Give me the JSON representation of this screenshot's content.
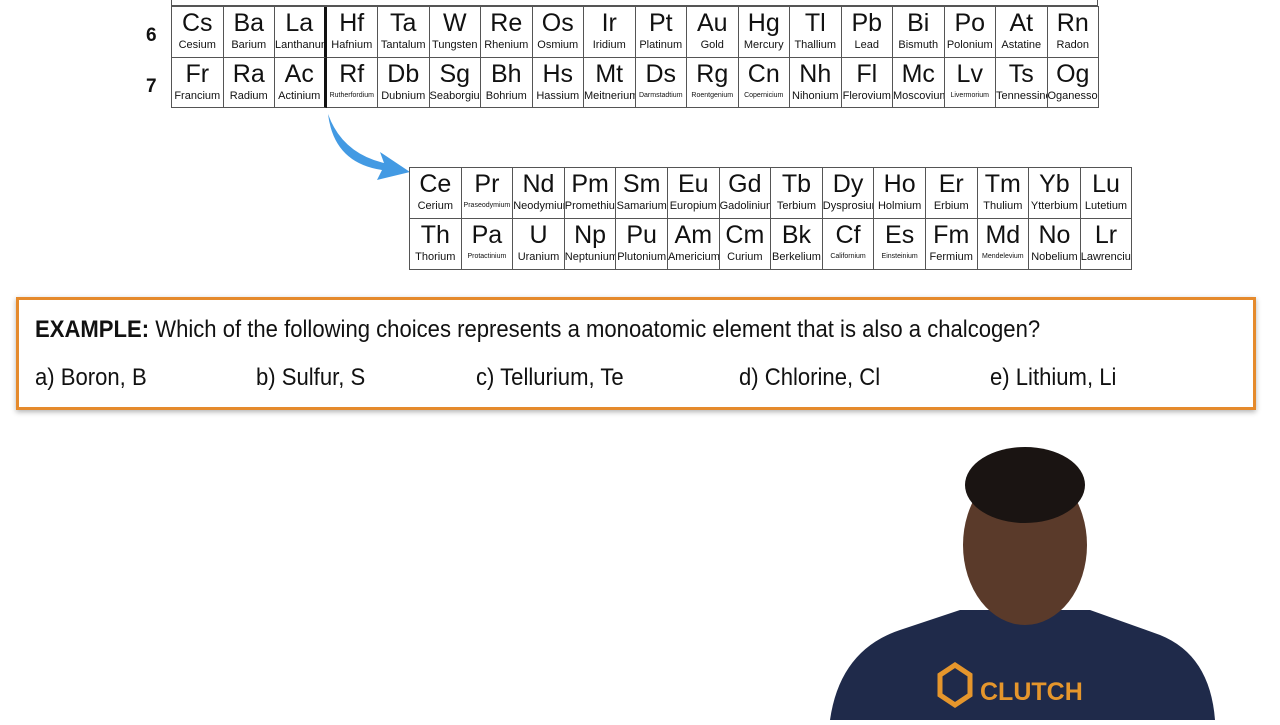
{
  "periods": [
    "6",
    "7"
  ],
  "main_table": [
    [
      [
        "Cs",
        "Cesium"
      ],
      [
        "Ba",
        "Barium"
      ],
      [
        "La",
        "Lanthanum"
      ],
      [
        "Hf",
        "Hafnium"
      ],
      [
        "Ta",
        "Tantalum"
      ],
      [
        "W",
        "Tungsten"
      ],
      [
        "Re",
        "Rhenium"
      ],
      [
        "Os",
        "Osmium"
      ],
      [
        "Ir",
        "Iridium"
      ],
      [
        "Pt",
        "Platinum"
      ],
      [
        "Au",
        "Gold"
      ],
      [
        "Hg",
        "Mercury"
      ],
      [
        "Tl",
        "Thallium"
      ],
      [
        "Pb",
        "Lead"
      ],
      [
        "Bi",
        "Bismuth"
      ],
      [
        "Po",
        "Polonium"
      ],
      [
        "At",
        "Astatine"
      ],
      [
        "Rn",
        "Radon"
      ]
    ],
    [
      [
        "Fr",
        "Francium"
      ],
      [
        "Ra",
        "Radium"
      ],
      [
        "Ac",
        "Actinium"
      ],
      [
        "Rf",
        "Rutherfordium"
      ],
      [
        "Db",
        "Dubnium"
      ],
      [
        "Sg",
        "Seaborgium"
      ],
      [
        "Bh",
        "Bohrium"
      ],
      [
        "Hs",
        "Hassium"
      ],
      [
        "Mt",
        "Meitnerium"
      ],
      [
        "Ds",
        "Darmstadtium"
      ],
      [
        "Rg",
        "Roentgenium"
      ],
      [
        "Cn",
        "Copernicium"
      ],
      [
        "Nh",
        "Nihonium"
      ],
      [
        "Fl",
        "Flerovium"
      ],
      [
        "Mc",
        "Moscovium"
      ],
      [
        "Lv",
        "Livermorium"
      ],
      [
        "Ts",
        "Tennessine"
      ],
      [
        "Og",
        "Oganesson"
      ]
    ]
  ],
  "f_block": [
    [
      [
        "Ce",
        "Cerium"
      ],
      [
        "Pr",
        "Praseodymium"
      ],
      [
        "Nd",
        "Neodymium"
      ],
      [
        "Pm",
        "Promethium"
      ],
      [
        "Sm",
        "Samarium"
      ],
      [
        "Eu",
        "Europium"
      ],
      [
        "Gd",
        "Gadolinium"
      ],
      [
        "Tb",
        "Terbium"
      ],
      [
        "Dy",
        "Dysprosium"
      ],
      [
        "Ho",
        "Holmium"
      ],
      [
        "Er",
        "Erbium"
      ],
      [
        "Tm",
        "Thulium"
      ],
      [
        "Yb",
        "Ytterbium"
      ],
      [
        "Lu",
        "Lutetium"
      ]
    ],
    [
      [
        "Th",
        "Thorium"
      ],
      [
        "Pa",
        "Protactinium"
      ],
      [
        "U",
        "Uranium"
      ],
      [
        "Np",
        "Neptunium"
      ],
      [
        "Pu",
        "Plutonium"
      ],
      [
        "Am",
        "Americium"
      ],
      [
        "Cm",
        "Curium"
      ],
      [
        "Bk",
        "Berkelium"
      ],
      [
        "Cf",
        "Californium"
      ],
      [
        "Es",
        "Einsteinium"
      ],
      [
        "Fm",
        "Fermium"
      ],
      [
        "Md",
        "Mendelevium"
      ],
      [
        "No",
        "Nobelium"
      ],
      [
        "Lr",
        "Lawrencium"
      ]
    ]
  ],
  "example": {
    "label": "EXAMPLE:",
    "question": "Which of the following choices represents a monoatomic element that is also a chalcogen?",
    "options": [
      "a) Boron, B",
      "b) Sulfur, S",
      "c) Tellurium, Te",
      "d) Chlorine, Cl",
      "e) Lithium, Li"
    ]
  },
  "brand": "CLUTCH",
  "colors": {
    "accent": "#e58a2c",
    "arrow": "#2f8fe0"
  }
}
